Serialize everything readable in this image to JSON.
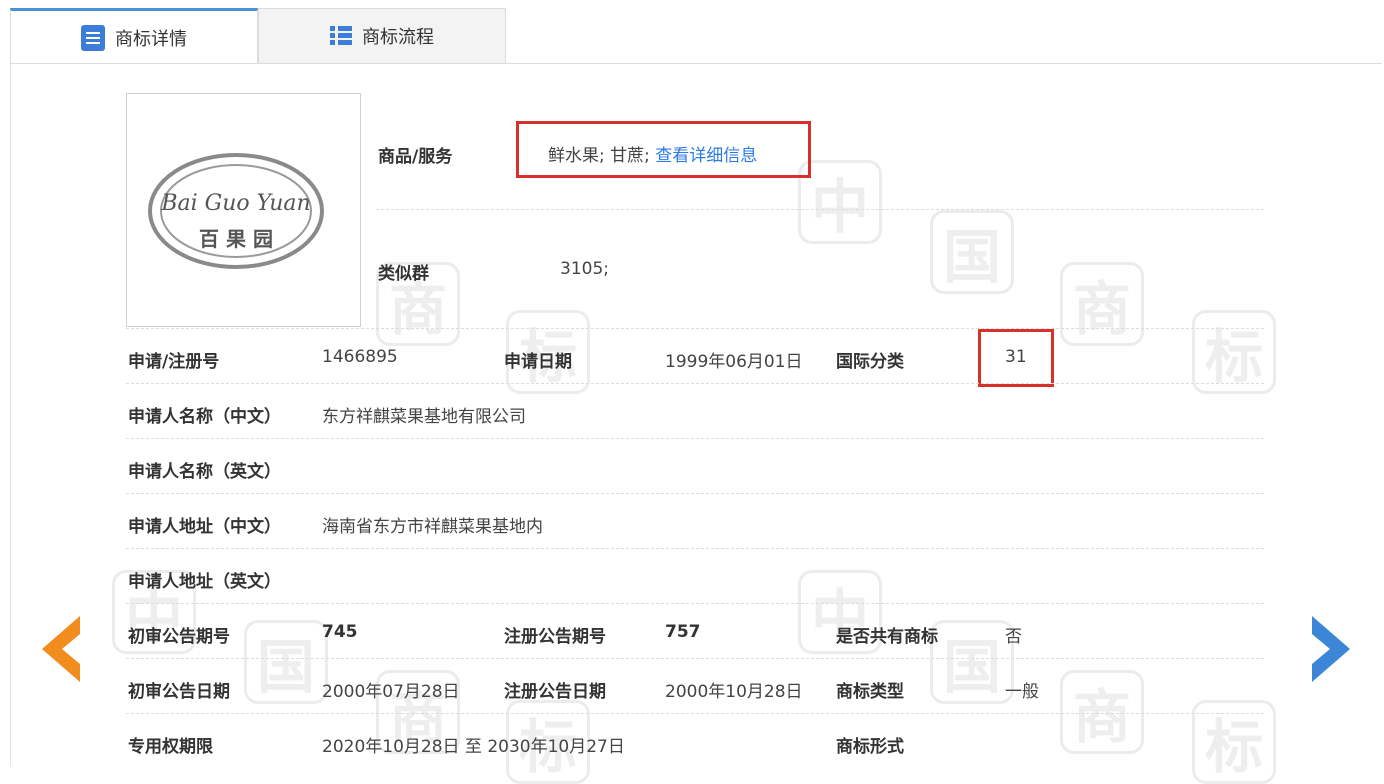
{
  "tabs": [
    {
      "label": "商标详情",
      "icon": "document-list-icon",
      "active": true
    },
    {
      "label": "商标流程",
      "icon": "bullet-list-icon",
      "active": false
    }
  ],
  "watermark": [
    "中",
    "国",
    "商",
    "标"
  ],
  "logo": {
    "line1": "Bai Guo Yuan",
    "line2": "百 果 园"
  },
  "goods": {
    "label": "商品/服务",
    "value": "鲜水果; 甘蔗; ",
    "link": "查看详细信息"
  },
  "similar": {
    "label": "类似群",
    "value": "3105;"
  },
  "row_reg": {
    "reg_label": "申请/注册号",
    "reg_value": "1466895",
    "date_label": "申请日期",
    "date_value": "1999年06月01日",
    "class_label": "国际分类",
    "class_value": "31"
  },
  "applicant_cn": {
    "label": "申请人名称（中文）",
    "value": "东方祥麒菜果基地有限公司"
  },
  "applicant_en": {
    "label": "申请人名称（英文）",
    "value": ""
  },
  "address_cn": {
    "label": "申请人地址（中文）",
    "value": "海南省东方市祥麒菜果基地内"
  },
  "address_en": {
    "label": "申请人地址（英文）",
    "value": ""
  },
  "row_issue": {
    "prelim_label": "初审公告期号",
    "prelim_value": "745",
    "reg_label": "注册公告期号",
    "reg_value": "757",
    "shared_label": "是否共有商标",
    "shared_value": "否"
  },
  "row_dates": {
    "prelim_label": "初审公告日期",
    "prelim_value": "2000年07月28日",
    "reg_label": "注册公告日期",
    "reg_value": "2000年10月28日",
    "type_label": "商标类型",
    "type_value": "一般"
  },
  "row_term": {
    "term_label": "专用权期限",
    "term_value": "2020年10月28日 至 2030年10月27日",
    "form_label": "商标形式",
    "form_value": ""
  },
  "colors": {
    "accent": "#3b7dd8",
    "highlight": "#d8312b",
    "prev_arrow": "#f28c1c",
    "next_arrow": "#3b86d6"
  }
}
